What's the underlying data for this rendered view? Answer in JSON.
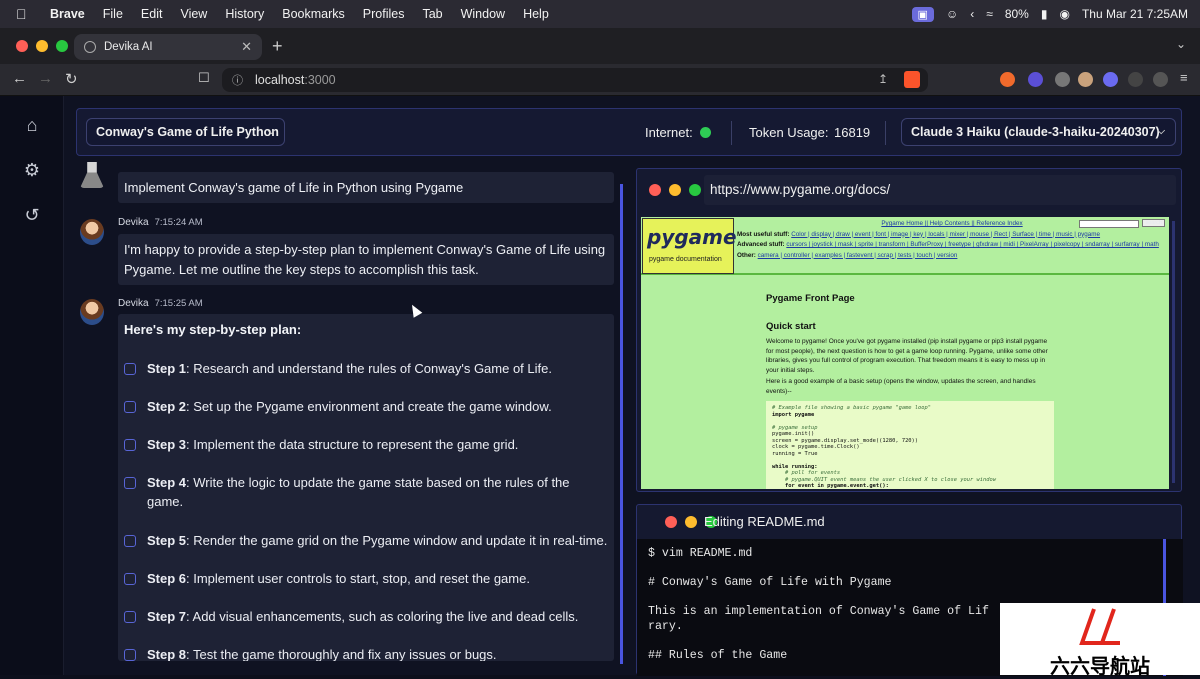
{
  "menubar": {
    "app": "Brave",
    "items": [
      "File",
      "Edit",
      "View",
      "History",
      "Bookmarks",
      "Profiles",
      "Tab",
      "Window",
      "Help"
    ],
    "battery": "80%",
    "datetime": "Thu Mar 21  7:25AM"
  },
  "tab": {
    "title": "Devika AI"
  },
  "address": {
    "host": "localhost",
    "port": ":3000"
  },
  "control_panel": {
    "project": "Conway's Game of Life Python",
    "internet_label": "Internet:",
    "token_label": "Token Usage:",
    "token_value": "16819",
    "model": "Claude 3 Haiku (claude-3-haiku-20240307)",
    "internet_status_color": "#2ecc55"
  },
  "chat": {
    "user_message": "Implement Conway's game of Life in Python using Pygame",
    "reply1": {
      "author": "Devika",
      "time": "7:15:24 AM",
      "text": "I'm happy to provide a step-by-step plan to implement Conway's Game of Life using Pygame. Let me outline the key steps to accomplish this task."
    },
    "reply2": {
      "author": "Devika",
      "time": "7:15:25 AM"
    },
    "plan_title": "Here's my step-by-step plan:",
    "steps": [
      {
        "label": "Step 1",
        "text": ": Research and understand the rules of Conway's Game of Life."
      },
      {
        "label": "Step 2",
        "text": ": Set up the Pygame environment and create the game window."
      },
      {
        "label": "Step 3",
        "text": ": Implement the data structure to represent the game grid."
      },
      {
        "label": "Step 4",
        "text": ": Write the logic to update the game state based on the rules of the game."
      },
      {
        "label": "Step 5",
        "text": ": Render the game grid on the Pygame window and update it in real-time."
      },
      {
        "label": "Step 6",
        "text": ": Implement user controls to start, stop, and reset the game."
      },
      {
        "label": "Step 7",
        "text": ": Add visual enhancements, such as coloring the live and dead cells."
      },
      {
        "label": "Step 8",
        "text": ": Test the game thoroughly and fix any issues or bugs."
      }
    ]
  },
  "browser_panel": {
    "url": "https://www.pygame.org/docs/",
    "page": {
      "logo": "pygame",
      "logo_sub": "pygame documentation",
      "nav_top": "Pygame Home || Help Contents || Reference Index",
      "search_btn": "search",
      "most_useful_label": "Most useful stuff:",
      "most_useful": "Color | display | draw | event | font | image | key | locals | mixer | mouse | Rect | Surface | time | music | pygame",
      "advanced_label": "Advanced stuff:",
      "advanced": "cursors | joystick | mask | sprite | transform | BufferProxy | freetype | gfxdraw | midi | PixelArray | pixelcopy | sndarray | surfarray | math",
      "other_label": "Other:",
      "other": "camera | controller | examples | fastevent | scrap | tests | touch | version",
      "h1": "Pygame Front Page",
      "h2": "Quick start",
      "p1": "Welcome to pygame! Once you've got pygame installed (pip install pygame or pip3 install pygame for most people), the next question is how to get a game loop running. Pygame, unlike some other libraries, gives you full control of program execution. That freedom means it is easy to mess up in your initial steps.",
      "p2": "Here is a good example of a basic setup (opens the window, updates the screen, and handles events)--",
      "code": [
        "# Example file showing a basic pygame \"game loop\"",
        "import pygame",
        "",
        "# pygame setup",
        "pygame.init()",
        "screen = pygame.display.set_mode((1280, 720))",
        "clock = pygame.time.Clock()",
        "running = True",
        "",
        "while running:",
        "    # poll for events",
        "    # pygame.QUIT event means the user clicked X to close your window",
        "    for event in pygame.event.get():"
      ]
    }
  },
  "terminal": {
    "title": "Editing README.md",
    "lines": [
      "$ vim README.md",
      "",
      "# Conway's Game of Life with Pygame",
      "",
      "This is an implementation of Conway's Game of Lif",
      "rary.",
      "",
      "## Rules of the Game"
    ]
  },
  "watermark": {
    "text": "六六导航站"
  }
}
